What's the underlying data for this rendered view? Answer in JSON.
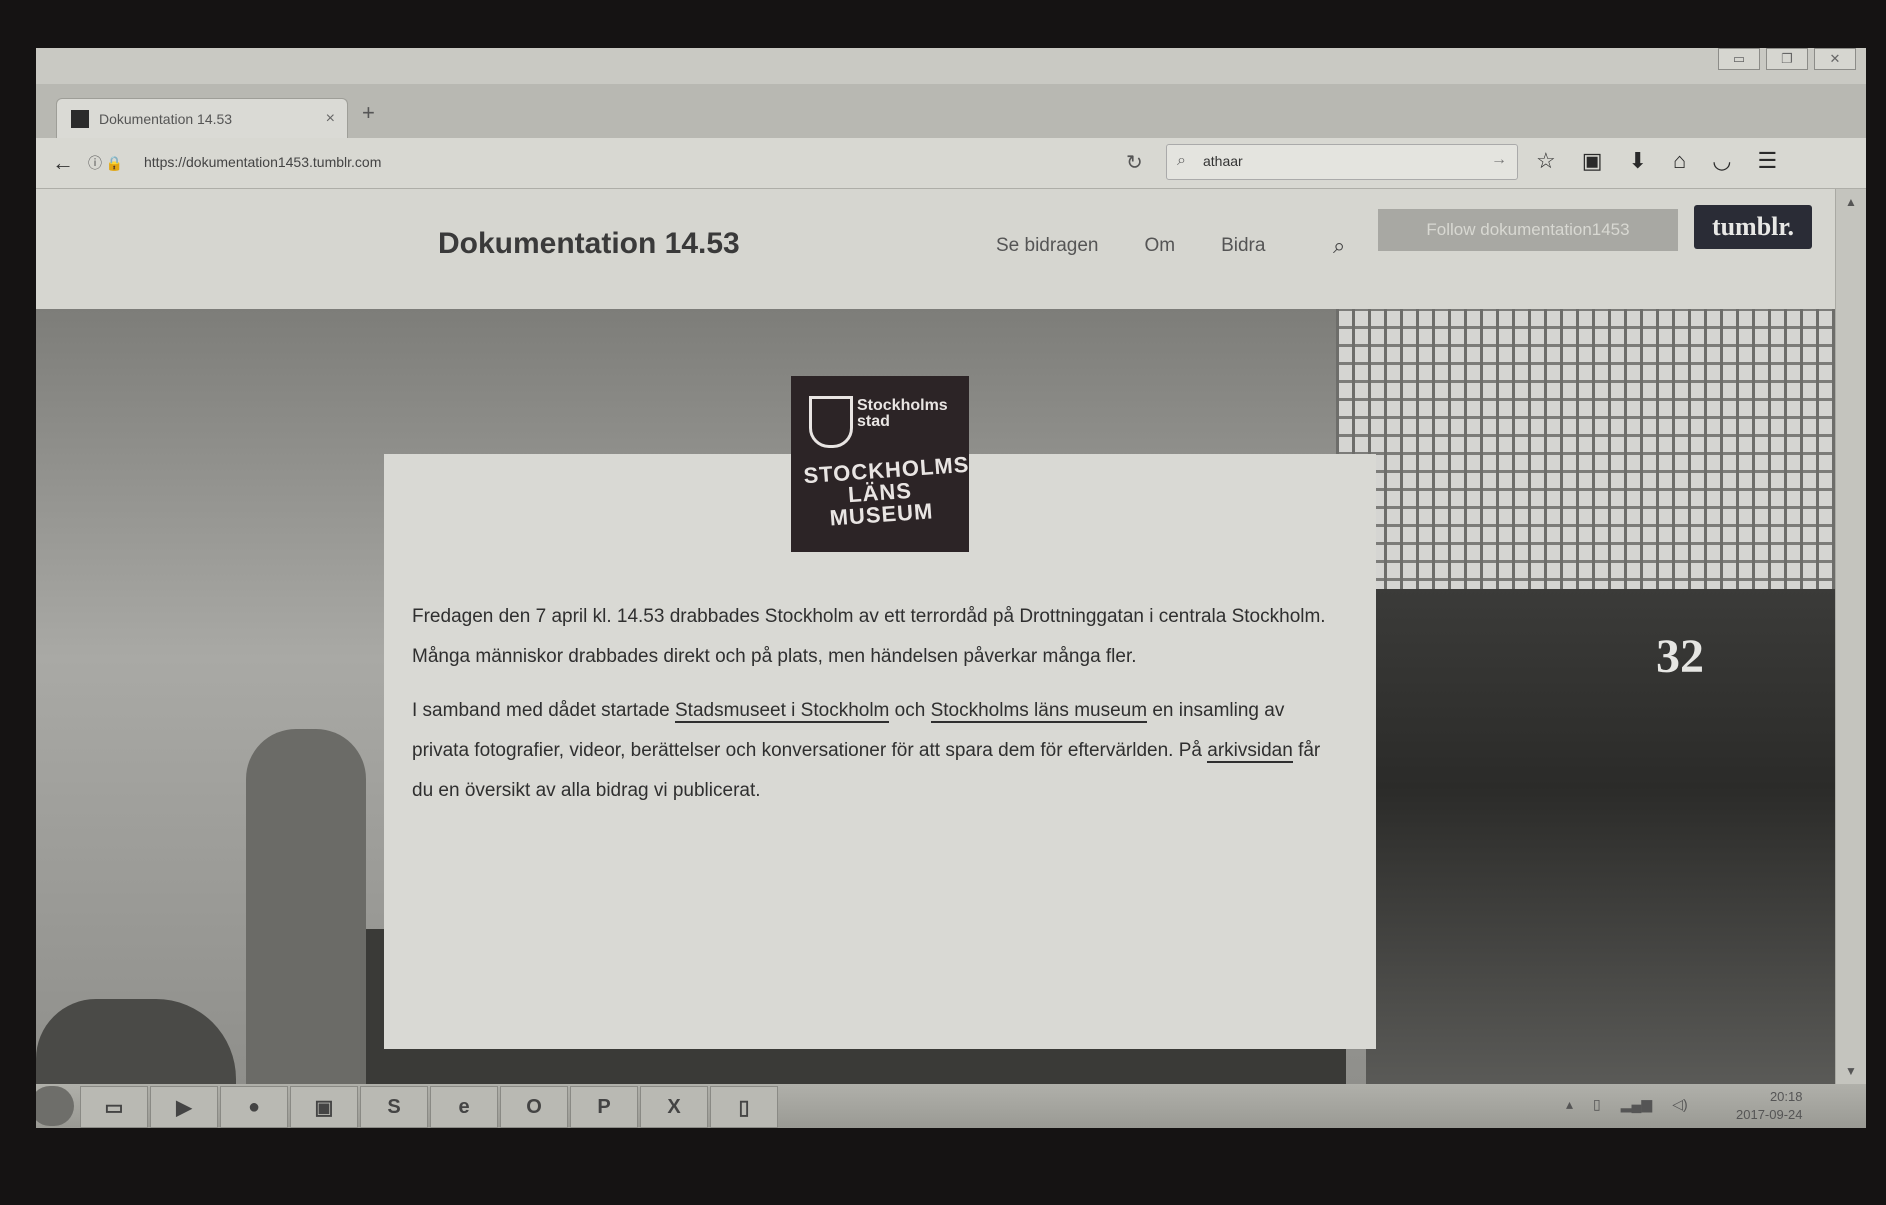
{
  "browser": {
    "tab_title": "Dokumentation 14.53",
    "tab_close": "×",
    "new_tab": "+",
    "url": "https://dokumentation1453.tumblr.com",
    "search_query": "athaar"
  },
  "site": {
    "title": "Dokumentation 14.53",
    "nav": [
      "Se bidragen",
      "Om",
      "Bidra"
    ],
    "follow_label": "Follow dokumentation1453",
    "tumblr_label": "tumblr."
  },
  "logo": {
    "line1": "Stockholms",
    "line2": "stad",
    "museum_line1": "STOCKHOLMS",
    "museum_line2": "LÄNS",
    "museum_line3": "MUSEUM"
  },
  "content": {
    "p1": "Fredagen den 7 april kl. 14.53 drabbades Stockholm av ett terrordåd på Drottninggatan i centrala Stockholm. Många människor drabbades direkt och på plats, men händelsen påverkar många fler.",
    "p2_a": "I samband med dådet startade ",
    "p2_link1": "Stadsmuseet i Stockholm",
    "p2_b": " och ",
    "p2_link2": "Stockholms läns museum",
    "p2_c": " en insamling av privata fotografier, videor, berättelser och konversationer för att spara dem för eftervärlden. På ",
    "p2_link3": "arkivsidan",
    "p2_d": " får du en översikt av alla bidrag vi publicerat."
  },
  "photo": {
    "jersey_number": "32"
  },
  "taskbar": {
    "time": "20:18",
    "date": "2017-09-24",
    "apps": [
      "file-explorer",
      "media-player",
      "firefox",
      "app",
      "skype",
      "internet-explorer",
      "outlook",
      "powerpoint",
      "excel",
      "app-blank"
    ]
  }
}
